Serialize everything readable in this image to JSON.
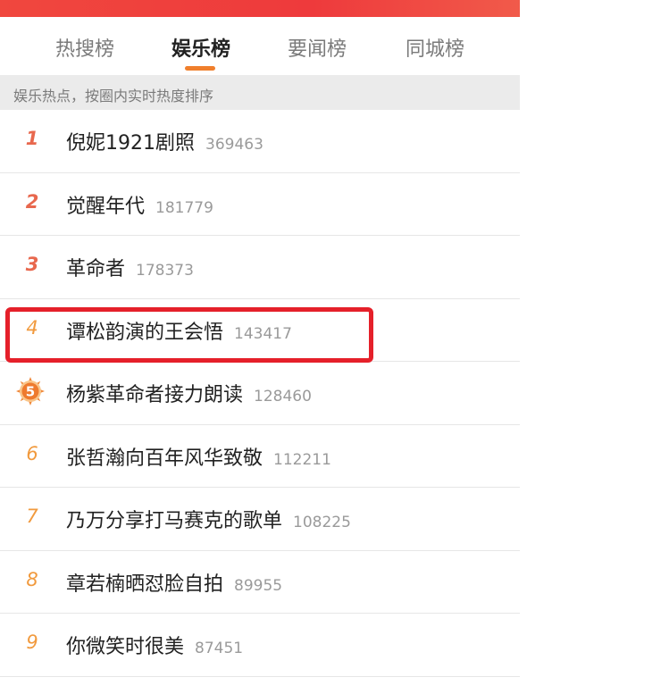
{
  "tabs": [
    {
      "label": "热搜榜",
      "active": false
    },
    {
      "label": "娱乐榜",
      "active": true
    },
    {
      "label": "要闻榜",
      "active": false
    },
    {
      "label": "同城榜",
      "active": false
    }
  ],
  "subheader": "娱乐热点，按圈内实时热度排序",
  "colors": {
    "banner": "#ee3a3c",
    "tab_indicator": "#f07f2c",
    "rank_top": "#e8684e",
    "rank_normal": "#f19a3e",
    "highlight_box": "#e5202a"
  },
  "items": [
    {
      "rank": "1",
      "title": "倪妮1921剧照",
      "count": "369463"
    },
    {
      "rank": "2",
      "title": "觉醒年代",
      "count": "181779"
    },
    {
      "rank": "3",
      "title": "革命者",
      "count": "178373"
    },
    {
      "rank": "4",
      "title": "谭松韵演的王会悟",
      "count": "143417"
    },
    {
      "rank": "5",
      "title": "杨紫革命者接力朗读",
      "count": "128460",
      "badge_icon": "sun-badge-icon"
    },
    {
      "rank": "6",
      "title": "张哲瀚向百年风华致敬",
      "count": "112211"
    },
    {
      "rank": "7",
      "title": "乃万分享打马赛克的歌单",
      "count": "108225"
    },
    {
      "rank": "8",
      "title": "章若楠晒怼脸自拍",
      "count": "89955"
    },
    {
      "rank": "9",
      "title": "你微笑时很美",
      "count": "87451"
    }
  ]
}
